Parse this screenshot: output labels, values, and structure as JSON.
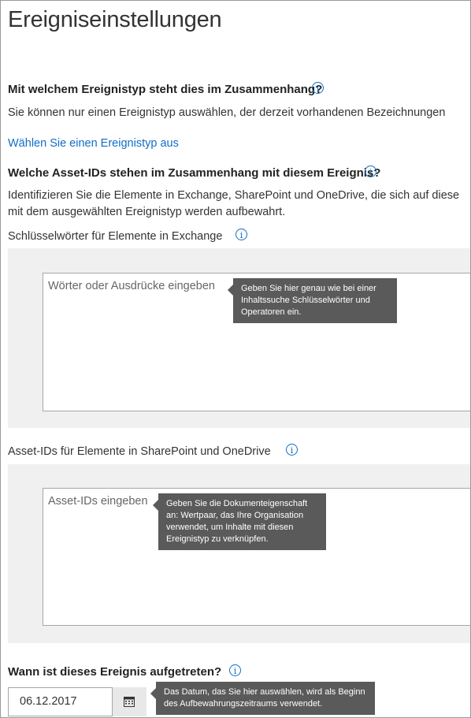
{
  "page": {
    "title": "Ereigniseinstellungen"
  },
  "event_type": {
    "question": "Mit welchem Ereignistyp steht dies im Zusammenhang?",
    "description": "Sie können nur einen Ereignistyp auswählen, der derzeit vorhandenen Bezeichnungen",
    "link": "Wählen Sie einen Ereignistyp aus"
  },
  "asset_ids": {
    "question": "Welche Asset-IDs stehen im Zusammenhang mit diesem Ereignis?",
    "description_line1": "Identifizieren Sie die Elemente in Exchange, SharePoint und OneDrive, die sich auf diese",
    "description_line2": "mit dem ausgewählten Ereignistyp werden aufbewahrt."
  },
  "exchange": {
    "label": "Schlüsselwörter für Elemente in Exchange",
    "placeholder": "Wörter oder Ausdrücke eingeben",
    "tooltip": "Geben Sie hier genau wie bei einer Inhaltssuche Schlüsselwörter und Operatoren ein."
  },
  "sharepoint": {
    "label": "Asset-IDs für Elemente in SharePoint und OneDrive",
    "placeholder": "Asset-IDs eingeben",
    "tooltip": "Geben Sie die Dokumenteigenschaft an: Wertpaar, das Ihre Organisation verwendet, um Inhalte mit diesen Ereignistyp zu verknüpfen."
  },
  "date": {
    "question": "Wann ist dieses Ereignis aufgetreten?",
    "value": "06.12.2017",
    "tooltip": "Das Datum, das Sie hier auswählen, wird als Beginn des Aufbewahrungszeitraums verwendet."
  },
  "icons": {
    "info": "info-icon",
    "calendar": "calendar-icon"
  },
  "colors": {
    "link": "#0f6ec6",
    "tooltip_bg": "#5a5a5a",
    "panel_bg": "#f0f0f0"
  }
}
